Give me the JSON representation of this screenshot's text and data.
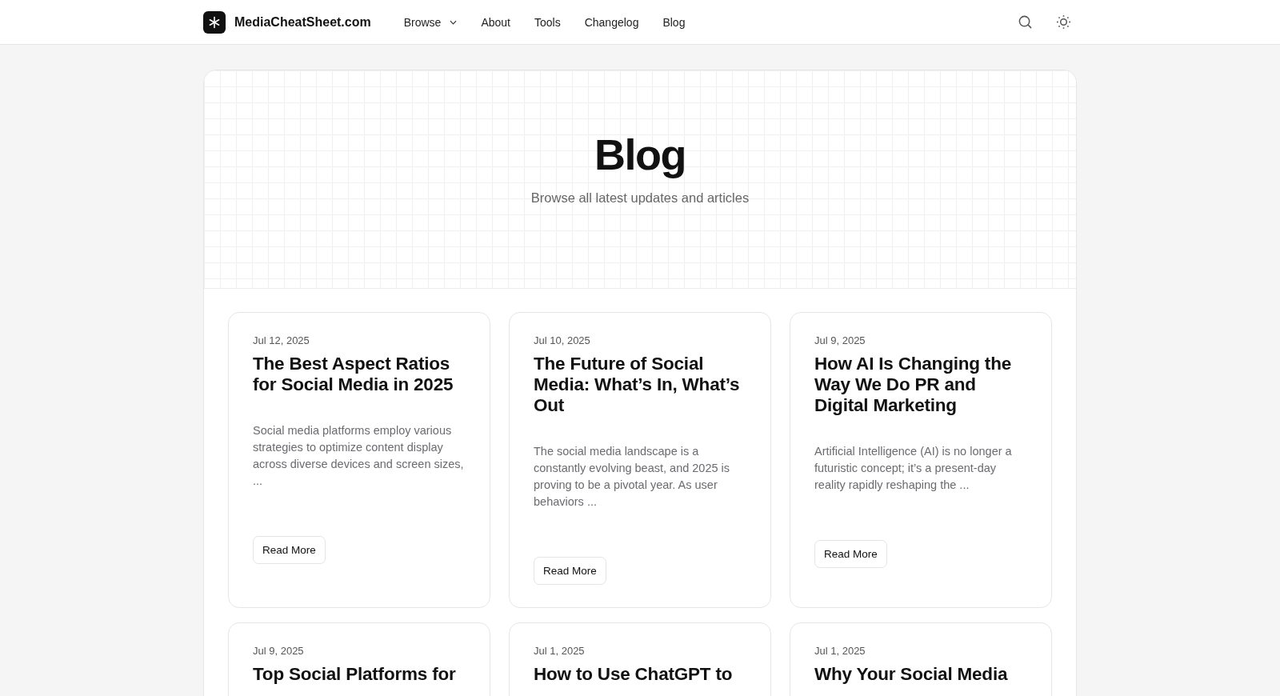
{
  "site": {
    "name": "MediaCheatSheet.com"
  },
  "nav": [
    {
      "label": "Browse",
      "kind": "dropdown"
    },
    {
      "label": "About",
      "kind": "link"
    },
    {
      "label": "Tools",
      "kind": "link"
    },
    {
      "label": "Changelog",
      "kind": "link"
    },
    {
      "label": "Blog",
      "kind": "link"
    }
  ],
  "hero": {
    "title": "Blog",
    "subtitle": "Browse all latest updates and articles"
  },
  "posts": [
    {
      "date": "Jul 12, 2025",
      "title": "The Best Aspect Ratios for Social Media in 2025",
      "excerpt": "Social media platforms employ various strategies to optimize content display across diverse devices and screen sizes, ...",
      "button": "Read More"
    },
    {
      "date": "Jul 10, 2025",
      "title": "The Future of Social Media: What’s In, What’s Out",
      "excerpt": "The social media landscape is a constantly evolving beast, and 2025 is proving to be a pivotal year. As user behaviors ...",
      "button": "Read More"
    },
    {
      "date": "Jul 9, 2025",
      "title": "How AI Is Changing the Way We Do PR and Digital Marketing",
      "excerpt": "Artificial Intelligence (AI) is no longer a futuristic concept; it’s a present-day reality rapidly reshaping the ...",
      "button": "Read More"
    },
    {
      "date": "Jul 9, 2025",
      "title": "Top Social Platforms for"
    },
    {
      "date": "Jul 1, 2025",
      "title": "How to Use ChatGPT to"
    },
    {
      "date": "Jul 1, 2025",
      "title": "Why Your Social Media"
    }
  ]
}
